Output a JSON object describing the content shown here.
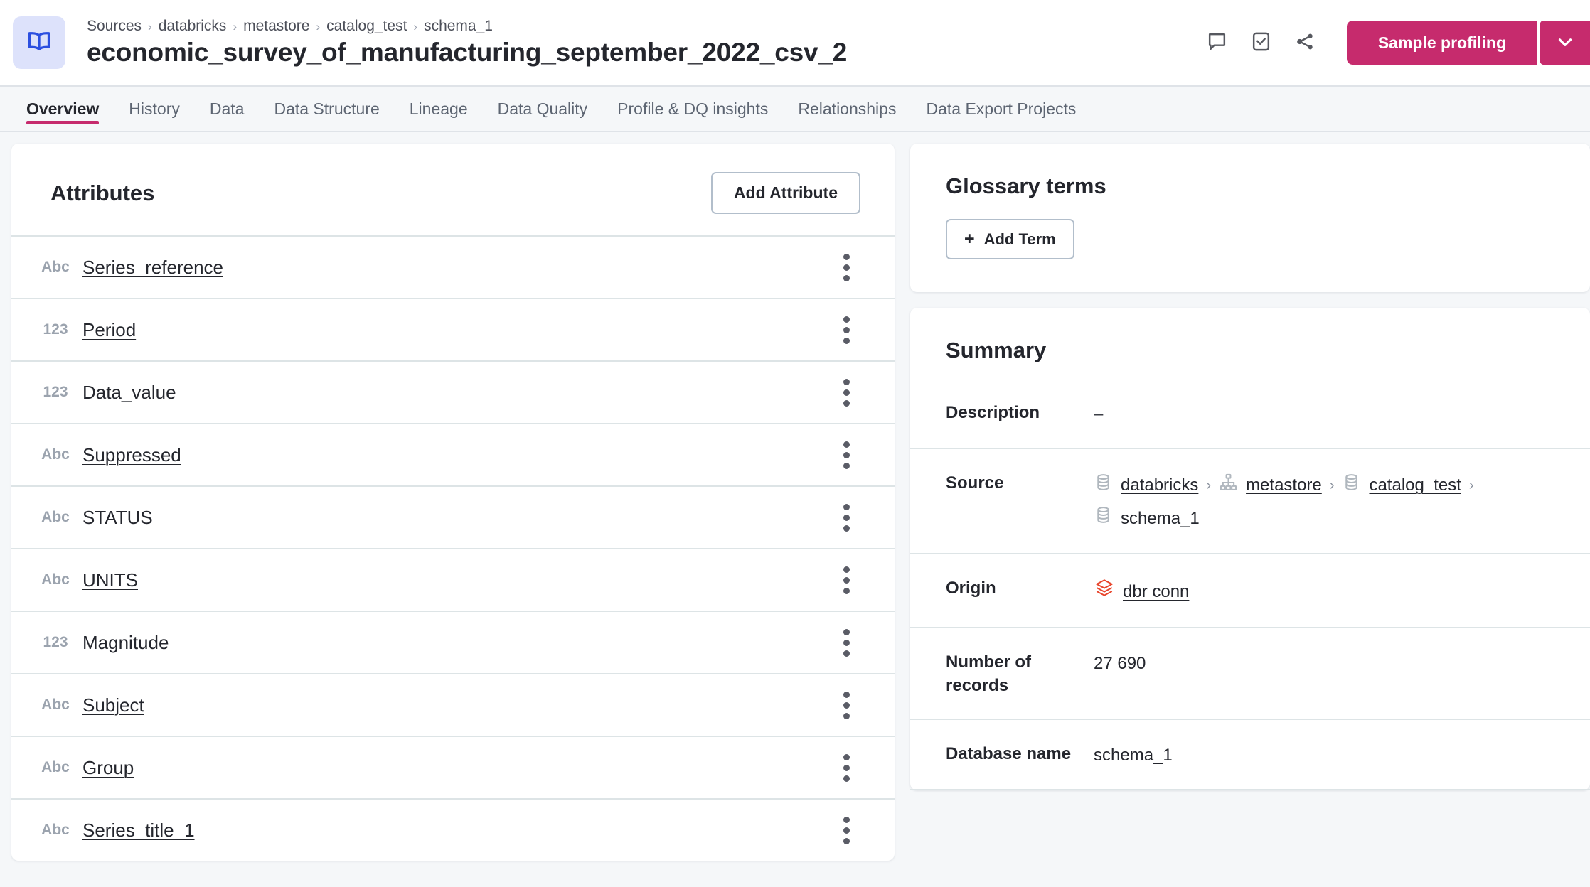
{
  "header": {
    "asset_icon": "open-book-icon",
    "breadcrumb": [
      {
        "label": "Sources"
      },
      {
        "label": "databricks"
      },
      {
        "label": "metastore"
      },
      {
        "label": "catalog_test"
      },
      {
        "label": "schema_1"
      }
    ],
    "breadcrumb_separator": "›",
    "title": "economic_survey_of_manufacturing_september_2022_csv_2",
    "actions": {
      "comment_icon": "comment-icon",
      "task_icon": "checkbox-task-icon",
      "share_icon": "share-icon",
      "primary_label": "Sample profiling",
      "primary_caret": "chevron-down-icon"
    }
  },
  "tabs": [
    {
      "label": "Overview",
      "active": true
    },
    {
      "label": "History",
      "active": false
    },
    {
      "label": "Data",
      "active": false
    },
    {
      "label": "Data Structure",
      "active": false
    },
    {
      "label": "Lineage",
      "active": false
    },
    {
      "label": "Data Quality",
      "active": false
    },
    {
      "label": "Profile & DQ insights",
      "active": false
    },
    {
      "label": "Relationships",
      "active": false
    },
    {
      "label": "Data Export Projects",
      "active": false
    }
  ],
  "attributes_panel": {
    "title": "Attributes",
    "add_button": "Add Attribute",
    "menu_icon": "kebab-menu-icon",
    "rows": [
      {
        "type": "Abc",
        "name": "Series_reference"
      },
      {
        "type": "123",
        "name": "Period"
      },
      {
        "type": "123",
        "name": "Data_value"
      },
      {
        "type": "Abc",
        "name": "Suppressed"
      },
      {
        "type": "Abc",
        "name": "STATUS"
      },
      {
        "type": "Abc",
        "name": "UNITS"
      },
      {
        "type": "123",
        "name": "Magnitude"
      },
      {
        "type": "Abc",
        "name": "Subject"
      },
      {
        "type": "Abc",
        "name": "Group"
      },
      {
        "type": "Abc",
        "name": "Series_title_1"
      }
    ]
  },
  "glossary_panel": {
    "title": "Glossary terms",
    "add_term_label": "Add Term",
    "add_term_plus": "+"
  },
  "summary_panel": {
    "title": "Summary",
    "description_label": "Description",
    "description_value": "–",
    "source_label": "Source",
    "source_chips": [
      {
        "icon": "database-icon",
        "label": "databricks",
        "sep": "›"
      },
      {
        "icon": "hierarchy-icon",
        "label": "metastore",
        "sep": "›"
      },
      {
        "icon": "database-icon",
        "label": "catalog_test",
        "sep": "›"
      },
      {
        "icon": "database-icon",
        "label": "schema_1",
        "sep": ""
      }
    ],
    "origin_label": "Origin",
    "origin_icon": "databricks-logo-icon",
    "origin_value": "dbr conn",
    "records_label": "Number of records",
    "records_value": "27 690",
    "database_label": "Database name",
    "database_value": "schema_1"
  },
  "colors": {
    "accent_pink": "#c62b6d",
    "icon_blue": "#2b4fe0",
    "icon_blue_bg": "#dde2fb",
    "databricks_red": "#e8452c",
    "page_bg": "#f5f7f9",
    "text_dark": "#24262d"
  }
}
